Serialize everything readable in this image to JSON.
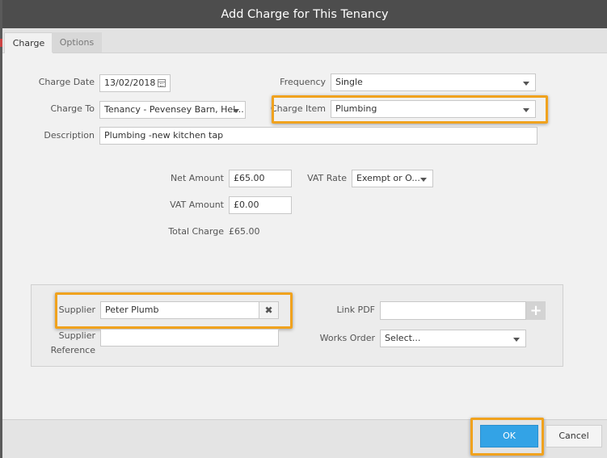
{
  "dialog": {
    "title": "Add Charge for This Tenancy"
  },
  "tabs": [
    {
      "label": "Charge",
      "active": true
    },
    {
      "label": "Options",
      "active": false
    }
  ],
  "form": {
    "charge_date": {
      "label": "Charge Date",
      "value": "13/02/2018"
    },
    "frequency": {
      "label": "Frequency",
      "value": "Single"
    },
    "charge_to": {
      "label": "Charge To",
      "value": "Tenancy - Pevensey Barn, Hel..."
    },
    "charge_item": {
      "label": "Charge Item",
      "value": "Plumbing"
    },
    "description": {
      "label": "Description",
      "value": "Plumbing  -new kitchen tap"
    },
    "net_amount": {
      "label": "Net Amount",
      "value": "£65.00"
    },
    "vat_rate": {
      "label": "VAT Rate",
      "value": "Exempt or O..."
    },
    "vat_amount": {
      "label": "VAT Amount",
      "value": "£0.00"
    },
    "total_charge": {
      "label": "Total Charge",
      "value": "£65.00"
    }
  },
  "supplier_section": {
    "supplier": {
      "label": "Supplier",
      "value": "Peter Plumb"
    },
    "supplier_reference": {
      "label_line1": "Supplier",
      "label_line2": "Reference",
      "value": ""
    },
    "link_pdf": {
      "label": "Link PDF",
      "value": ""
    },
    "works_order": {
      "label": "Works Order",
      "value": "Select..."
    }
  },
  "footer": {
    "ok_label": "OK",
    "cancel_label": "Cancel"
  },
  "colors": {
    "highlight": "#f0a21e",
    "ok_button": "#33a3e6",
    "titlebar": "#4d4d4d"
  }
}
